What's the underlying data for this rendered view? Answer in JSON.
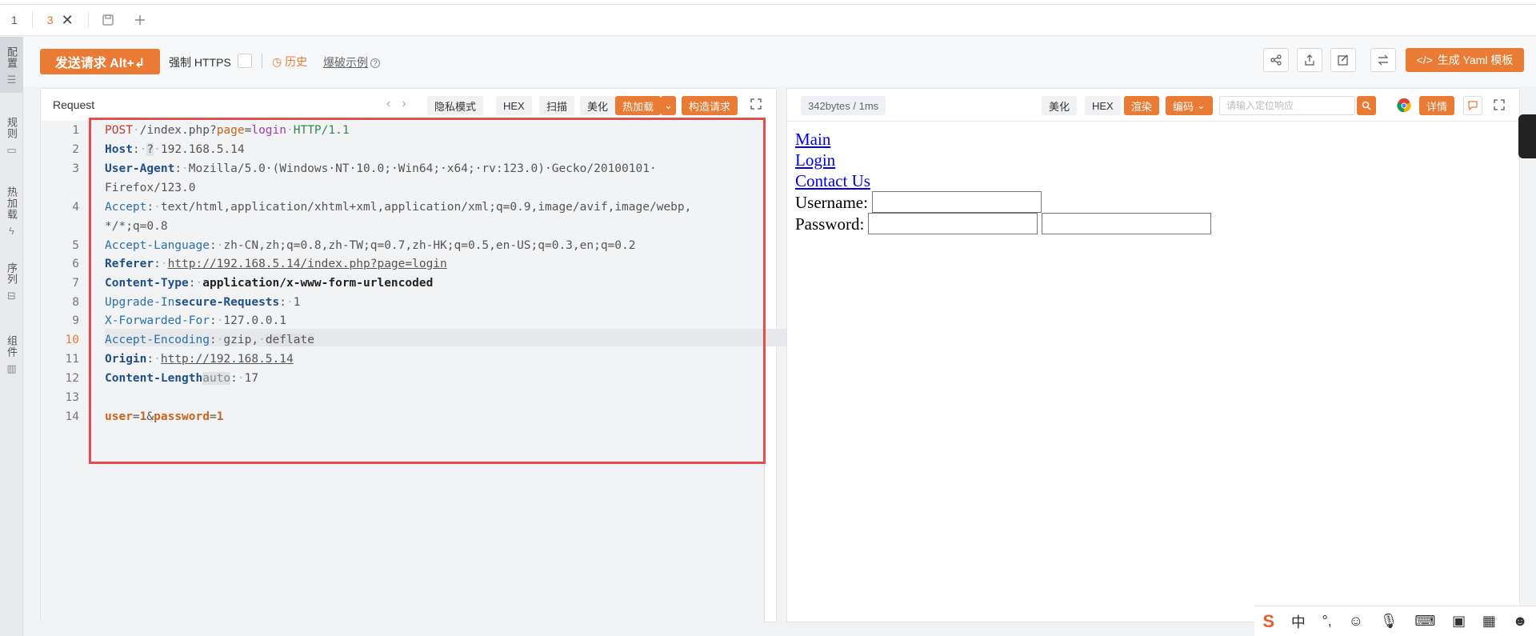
{
  "tabs": [
    {
      "label": "1"
    },
    {
      "label": "3",
      "close": "✕"
    }
  ],
  "sidebar": {
    "items": [
      {
        "label": "配置",
        "icon": "sliders-icon"
      },
      {
        "label": "规则",
        "icon": "clipboard-icon"
      },
      {
        "label": "热加载",
        "icon": "bolt-icon"
      },
      {
        "label": "序列",
        "icon": "layers-icon"
      },
      {
        "label": "组件",
        "icon": "grid-icon"
      }
    ]
  },
  "toolbar": {
    "send_label": "发送请求 Alt+↲",
    "https_label": "强制 HTTPS",
    "history_label": "历史",
    "blast_label": "爆破示例",
    "yaml_label": "生成 Yaml 模板"
  },
  "request": {
    "title": "Request",
    "buttons": {
      "private": "隐私模式",
      "hex": "HEX",
      "scan": "扫描",
      "beautify": "美化",
      "hotload": "热加载",
      "build": "构造请求"
    },
    "line_numbers": [
      "1",
      "2",
      "3",
      "4",
      "5",
      "6",
      "7",
      "8",
      "9",
      "10",
      "11",
      "12",
      "13",
      "14"
    ],
    "lines": {
      "l1": {
        "method": "POST",
        "path": "/index.php?",
        "param": "page",
        "eq": "=",
        "val": "login",
        "proto": "HTTP/1.1"
      },
      "l2": {
        "key": "Host",
        "hint": "?",
        "val": "192.168.5.14"
      },
      "l3": {
        "key": "User-Agent",
        "val": "Mozilla/5.0·(Windows·NT·10.0;·Win64;·x64;·rv:123.0)·Gecko/20100101·",
        "cont": "Firefox/123.0"
      },
      "l4": {
        "key": "Accept",
        "val": "text/html,application/xhtml+xml,application/xml;q=0.9,image/avif,image/webp,",
        "cont": "*/*;q=0.8"
      },
      "l5": {
        "key": "Accept-Language",
        "val": "zh-CN,zh;q=0.8,zh-TW;q=0.7,zh-HK;q=0.5,en-US;q=0.3,en;q=0.2"
      },
      "l6": {
        "key": "Referer",
        "val": "http://192.168.5.14/index.php?page=login"
      },
      "l7": {
        "key": "Content-Type",
        "val": "application/x-www-form-urlencoded"
      },
      "l8": {
        "key_a": "Upgrade-In",
        "key_b": "secure-Requests",
        "val": "1"
      },
      "l9": {
        "key": "X-Forwarded-For",
        "val": "127.0.0.1"
      },
      "l10": {
        "key": "Accept-Encoding",
        "val_a": "gzip,",
        "val_b": "deflate"
      },
      "l11": {
        "key": "Origin",
        "val": "http://192.168.5.14"
      },
      "l12": {
        "key": "Content-Length",
        "hint": "auto",
        "val": "17"
      },
      "l14": {
        "p1": "user",
        "v1": "1",
        "amp": "&",
        "p2": "password",
        "v2": "1"
      }
    }
  },
  "response": {
    "size": "342bytes / 1ms",
    "buttons": {
      "beautify": "美化",
      "hex": "HEX",
      "render": "渲染",
      "encode": "编码",
      "detail": "详情"
    },
    "search_placeholder": "请输入定位响应",
    "links": [
      "Main",
      "Login",
      "Contact Us"
    ],
    "username_label": "Username:",
    "password_label": "Password:"
  },
  "ime": {
    "logo": "S",
    "lang": "中",
    "punct": "°,"
  }
}
